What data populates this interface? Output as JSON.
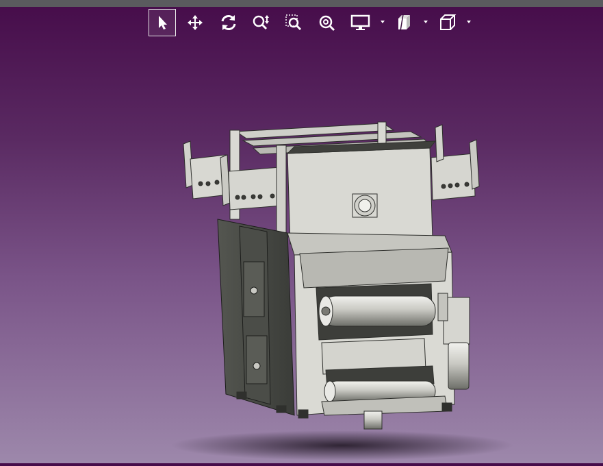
{
  "app": {
    "viewer": "3D CAD viewport"
  },
  "toolbar": {
    "tools": [
      {
        "name": "select",
        "icon": "arrow-cursor-icon",
        "active": true
      },
      {
        "name": "pan",
        "icon": "move-arrows-icon",
        "active": false
      },
      {
        "name": "rotate",
        "icon": "rotate-icon",
        "active": false
      },
      {
        "name": "zoom",
        "icon": "zoom-updown-icon",
        "active": false
      },
      {
        "name": "zoom-window",
        "icon": "zoom-window-icon",
        "active": false
      },
      {
        "name": "zoom-fit",
        "icon": "zoom-fit-icon",
        "active": false
      },
      {
        "name": "display-mode",
        "icon": "monitor-icon",
        "active": false,
        "has_dropdown": true
      },
      {
        "name": "section",
        "icon": "section-plane-icon",
        "active": false,
        "has_dropdown": true
      },
      {
        "name": "view-orientation",
        "icon": "cube-icon",
        "active": false,
        "has_dropdown": true
      }
    ]
  },
  "colors": {
    "background_top": "#460c4a",
    "background_bottom": "#9d88ab",
    "model_light": "#d6d6d0",
    "model_dark": "#3c3e3a",
    "toolbar_icon": "#ffffff"
  }
}
